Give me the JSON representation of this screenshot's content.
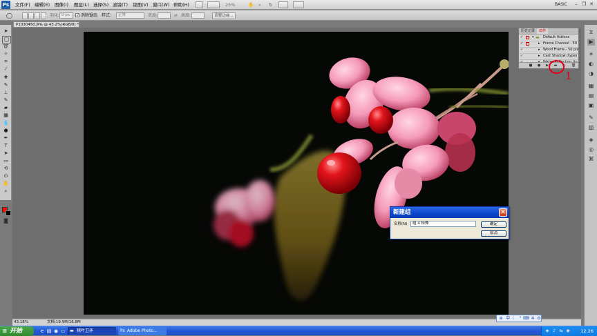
{
  "app": {
    "logo": "Ps"
  },
  "menu": {
    "items": [
      "文件(F)",
      "编辑(E)",
      "图像(I)",
      "图层(L)",
      "选择(S)",
      "滤镜(T)",
      "视图(V)",
      "窗口(W)",
      "帮助(H)"
    ],
    "zoom": "25%",
    "workspace": "BASIC"
  },
  "options": {
    "feather_label": "羽化:",
    "feather_value": "0 px",
    "antialias_label": "消除锯齿",
    "style_label": "样式:",
    "style_value": "正常",
    "width_label": "宽度:",
    "height_label": "高度:",
    "refine_label": "调整边缘..."
  },
  "document": {
    "tab_title": "P1030450.JPG @ 43.2%(RGB/8) *",
    "zoom_level": "43.18%",
    "doc_size": "文档:19.9M/16.8M"
  },
  "actions_panel": {
    "tabs": [
      "历史记录",
      "动作"
    ],
    "rows": [
      {
        "label": "Default Actions"
      },
      {
        "label": "Frame Channel - 50 ..."
      },
      {
        "label": "Wood Frame - 50 pixel"
      },
      {
        "label": "Cast Shadow (type)"
      },
      {
        "label": "Water Reflection (ty..."
      }
    ]
  },
  "annotation": {
    "number": "1"
  },
  "dialog": {
    "title": "新建组",
    "name_label": "名称(N):",
    "name_value": "组 4   特殊",
    "ok_label": "确定",
    "cancel_label": "取消",
    "close_glyph": "✕"
  },
  "taskbar": {
    "start_label": "开始",
    "tasks": [
      {
        "label": "桃叶卫矛"
      },
      {
        "label": "Adobe Photo..."
      }
    ],
    "clock": "12:26"
  },
  "colors": {
    "foreground": "#ff0000",
    "background": "#000000",
    "annotation": "#e2001a"
  }
}
